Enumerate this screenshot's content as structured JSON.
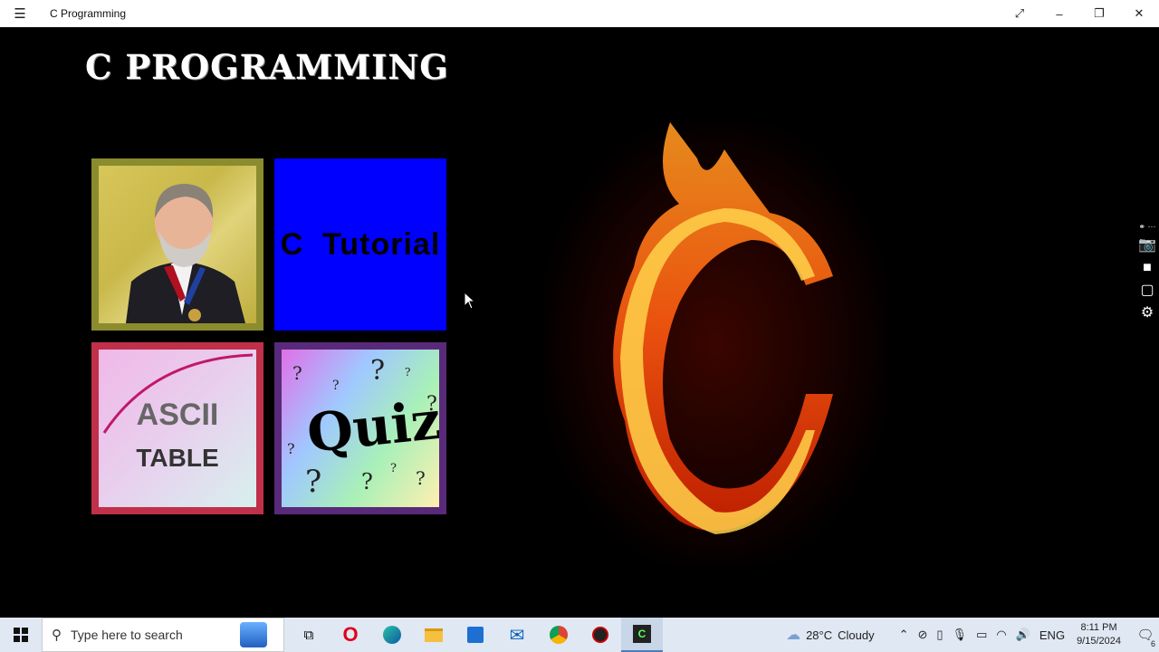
{
  "window": {
    "title": "C Programming",
    "controls": {
      "fullscreen": "⤢",
      "minimize": "–",
      "restore": "❐",
      "close": "✕"
    }
  },
  "app": {
    "heading": "C PROGRAMMING",
    "tiles": {
      "tutorial": {
        "label": "C  Tutorial",
        "color": "#0000ff"
      },
      "ascii": {
        "line1": "ASCII",
        "line2": "TABLE",
        "border_color": "#c0304a"
      },
      "quiz": {
        "label": "Quiz!",
        "border_color": "#5a2a7a"
      },
      "photo": {
        "border_color": "#8b8c2e"
      }
    }
  },
  "taskbar": {
    "search_placeholder": "Type here to search",
    "weather": {
      "temp": "28°C",
      "condition": "Cloudy"
    },
    "language": "ENG",
    "time": "8:11 PM",
    "date": "9/15/2024",
    "notification_count": "6"
  },
  "icons": {
    "menu": "hamburger-icon",
    "side_tools": [
      "link-icon",
      "camera-icon",
      "video-icon",
      "window-icon",
      "gear-icon"
    ],
    "taskbar_apps": [
      "task-view-icon",
      "opera-icon",
      "edge-icon",
      "file-explorer-icon",
      "store-icon",
      "mail-icon",
      "chrome-icon",
      "app-icon",
      "c-programming-icon"
    ]
  }
}
